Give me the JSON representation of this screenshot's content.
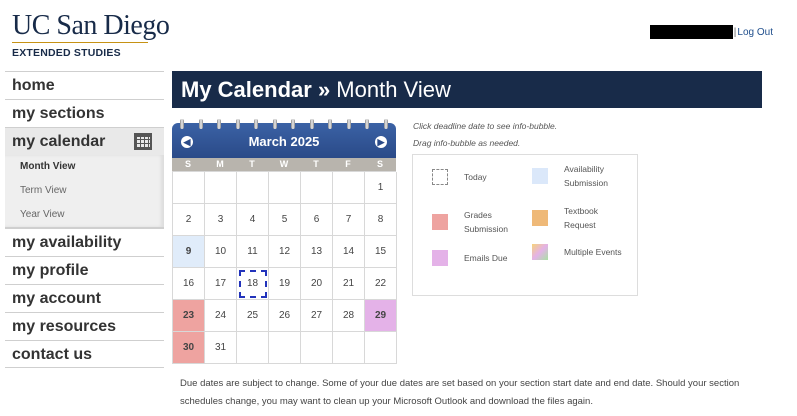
{
  "brand": {
    "line1": "UC San Diego",
    "line2": "EXTENDED STUDIES"
  },
  "userbar": {
    "separator": "|",
    "logout": "Log Out"
  },
  "nav": {
    "items": [
      "home",
      "my sections",
      "my calendar",
      "my availability",
      "my profile",
      "my account",
      "my resources",
      "contact us"
    ],
    "sub": [
      "Month View",
      "Term View",
      "Year View"
    ]
  },
  "banner": {
    "main": "My Calendar",
    "sep": " » ",
    "sub": "Month View"
  },
  "calendar": {
    "month": "March 2025",
    "prev_icon": "prev-arrow-icon",
    "next_icon": "next-arrow-icon",
    "dow": [
      "S",
      "M",
      "T",
      "W",
      "T",
      "F",
      "S"
    ],
    "weeks": [
      [
        "",
        "",
        "",
        "",
        "",
        "",
        "1"
      ],
      [
        "2",
        "3",
        "4",
        "5",
        "6",
        "7",
        "8"
      ],
      [
        "9",
        "10",
        "11",
        "12",
        "13",
        "14",
        "15"
      ],
      [
        "16",
        "17",
        "18",
        "19",
        "20",
        "21",
        "22"
      ],
      [
        "23",
        "24",
        "25",
        "26",
        "27",
        "28",
        "29"
      ],
      [
        "30",
        "31",
        "",
        "",
        "",
        "",
        ""
      ]
    ],
    "highlights": {
      "9": "availability",
      "18": "today",
      "23": "grades",
      "29": "emails",
      "30": "grades"
    }
  },
  "instructions": [
    "Click deadline date to see info-bubble.",
    "Drag info-bubble as needed."
  ],
  "legend": {
    "today": "Today",
    "availability": "Availability Submission",
    "grades": "Grades Submission",
    "textbook": "Textbook Request",
    "emails": "Emails Due",
    "multiple": "Multiple Events"
  },
  "colors": {
    "banner": "#182b49",
    "calendar_header": "#2a4a88",
    "availability": "#e0ecfa",
    "grades": "#eea3a0",
    "emails": "#e4b2e8",
    "textbook": "#efb978"
  },
  "note": "Due dates are subject to change. Some of your due dates are set based on your section start date and end date. Should your section schedules change, you may want to clean up your Microsoft Outlook and download the files again."
}
